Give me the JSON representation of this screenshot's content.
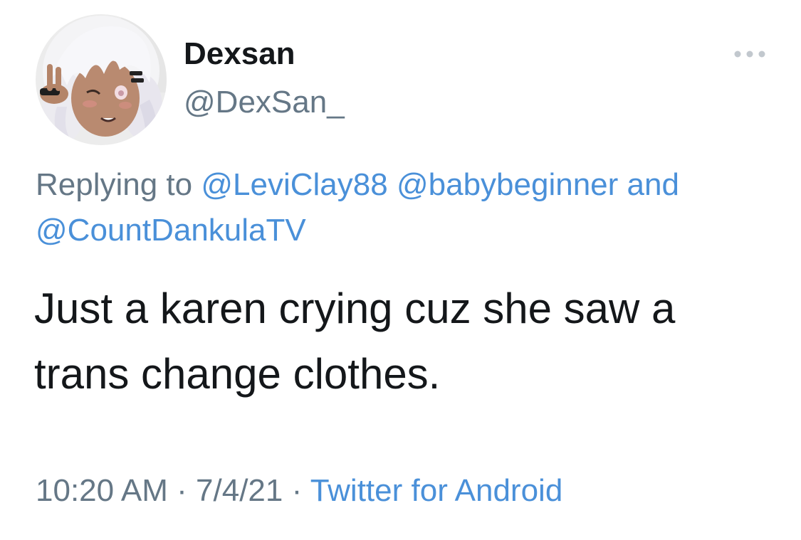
{
  "tweet": {
    "author": {
      "display_name": "Dexsan",
      "handle": "@DexSan_",
      "avatar": "anime-avatar-white-hair"
    },
    "more_icon": "more-horizontal-icon",
    "reply": {
      "prefix": "Replying to",
      "mentions": [
        "@LeviClay88",
        "@babybeginner",
        "@CountDankulaTV"
      ],
      "joiner": "and"
    },
    "text": "Just a karen crying cuz she saw a trans change clothes.",
    "meta": {
      "time": "10:20 AM",
      "separator": "·",
      "date": "7/4/21",
      "source": "Twitter for Android"
    }
  },
  "colors": {
    "name": "#14171a",
    "secondary": "#657786",
    "link": "#4a90d9",
    "background": "#ffffff"
  }
}
